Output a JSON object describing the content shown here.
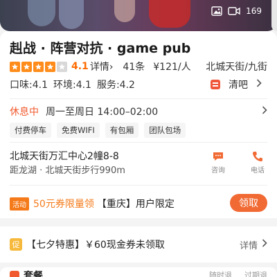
{
  "banner": {
    "media_count": "169"
  },
  "shop": {
    "name": "赳战 · 阵营对抗 · game pub",
    "score": "4.1",
    "detail_label": "详情",
    "reviews": "41条",
    "avg_price": "¥121/人",
    "region": "北城天街/九街",
    "taste": "口味:4.1",
    "environment": "环境:4.1",
    "service": "服务:4.2",
    "clear_label": "清吧",
    "status": "休息中",
    "hours": "周一至周日 14:00–02:00",
    "tags": [
      "付费停车",
      "免费WIFI",
      "有包厢",
      "团队包场"
    ],
    "address": "北城天街万汇中心2幢8-8",
    "distance": "距龙湖 · 北城天街步行990m",
    "consult_label": "咨询",
    "phone_label": "电话"
  },
  "coupon": {
    "badge": "活动",
    "amount": "50元券限量领",
    "city": "【重庆】用户限定",
    "claim": "领取"
  },
  "promo": {
    "badge": "促",
    "text": "【七夕特惠】￥60现金券未领取",
    "more": "详情"
  },
  "package": {
    "title": "套餐",
    "tag1": "随时退",
    "tag2": "过期退"
  },
  "colors": {
    "accent": "#f16a34",
    "star": "#ff8c1a",
    "status": "#f05a2e"
  }
}
